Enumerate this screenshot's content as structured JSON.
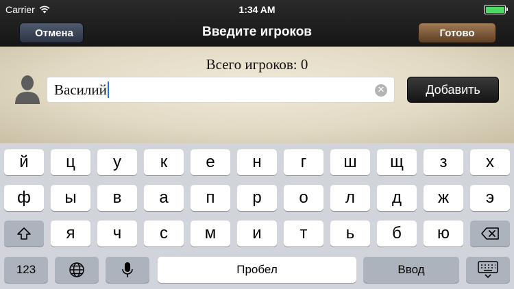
{
  "status": {
    "carrier": "Carrier",
    "time": "1:34 AM"
  },
  "nav": {
    "cancel": "Отмена",
    "title": "Введите игроков",
    "done": "Готово"
  },
  "content": {
    "count_label": "Всего игроков: 0",
    "name_value": "Василий",
    "add_button": "Добавить"
  },
  "keyboard": {
    "row1": [
      "й",
      "ц",
      "у",
      "к",
      "е",
      "н",
      "г",
      "ш",
      "щ",
      "з",
      "х"
    ],
    "row2": [
      "ф",
      "ы",
      "в",
      "а",
      "п",
      "р",
      "о",
      "л",
      "д",
      "ж",
      "э"
    ],
    "row3": [
      "я",
      "ч",
      "с",
      "м",
      "и",
      "т",
      "ь",
      "б",
      "ю"
    ],
    "numbers_key": "123",
    "space_key": "Пробел",
    "return_key": "Ввод"
  },
  "icons": {
    "wifi": "wifi-icon",
    "battery": "battery-icon",
    "avatar": "person-icon",
    "clear": "clear-icon",
    "shift": "shift-icon",
    "backspace": "backspace-icon",
    "globe": "globe-icon",
    "mic": "microphone-icon",
    "hide_keyboard": "keyboard-hide-icon"
  },
  "colors": {
    "battery_fill": "#4cd964",
    "caret": "#1d6ef5",
    "done_button": "#7a5636",
    "cancel_button": "#3a4456"
  }
}
